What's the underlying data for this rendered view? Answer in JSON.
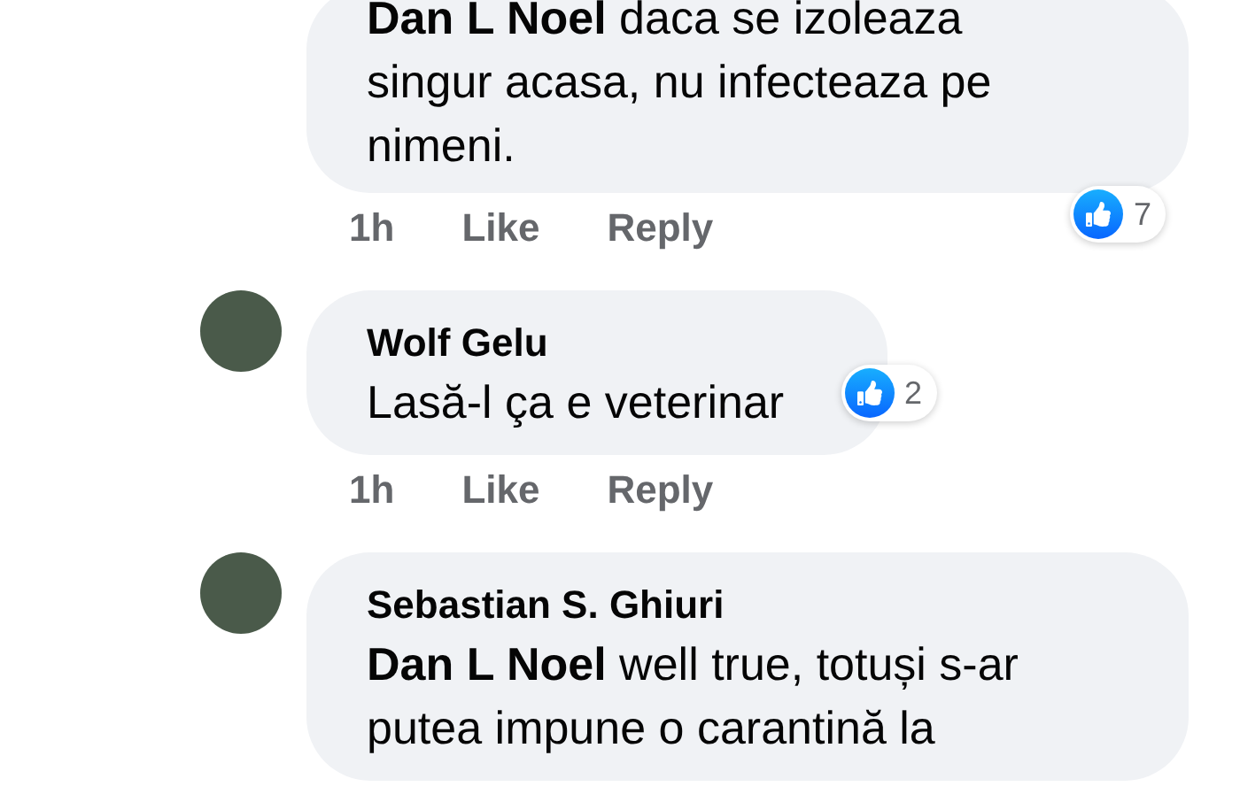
{
  "comments": [
    {
      "text": "**Dan L Noel** daca se izoleaza singur acasa, nu infecteaza pe nimeni.",
      "actions": [
        "1h",
        "Like",
        "Reply"
      ],
      "reactions": "7"
    },
    {
      "author": "Wolf Gelu",
      "text": "Lasă-l ça e veterinar",
      "actions": [
        "1h",
        "Like",
        "Reply"
      ],
      "reactions": "2"
    },
    {
      "author": "Sebastian S. Ghiuri",
      "text": "**Dan L Noel** well true, totuși s-ar putea impune o carantină la"
    }
  ]
}
